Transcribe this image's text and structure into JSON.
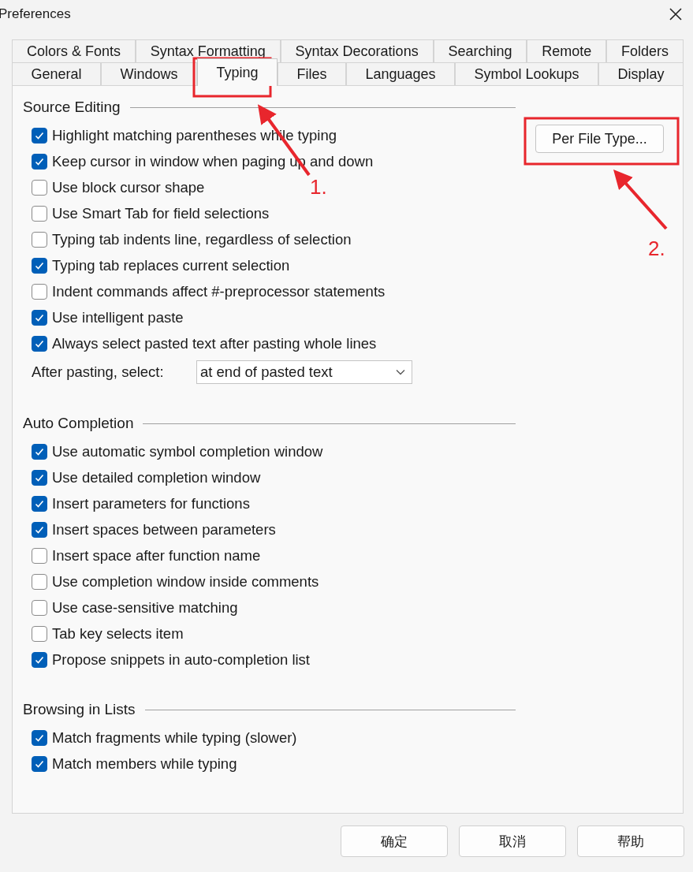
{
  "window": {
    "title": "Preferences"
  },
  "tab_rows": [
    [
      {
        "label": "Colors & Fonts",
        "selected": false
      },
      {
        "label": "Syntax Formatting",
        "selected": false
      },
      {
        "label": "Syntax Decorations",
        "selected": false
      },
      {
        "label": "Searching",
        "selected": false
      },
      {
        "label": "Remote",
        "selected": false
      },
      {
        "label": "Folders",
        "selected": false
      }
    ],
    [
      {
        "label": "General",
        "selected": false
      },
      {
        "label": "Windows",
        "selected": false
      },
      {
        "label": "Typing",
        "selected": true
      },
      {
        "label": "Files",
        "selected": false
      },
      {
        "label": "Languages",
        "selected": false
      },
      {
        "label": "Symbol Lookups",
        "selected": false
      },
      {
        "label": "Display",
        "selected": false
      }
    ]
  ],
  "per_file_type_button": "Per File Type...",
  "groups": [
    {
      "title": "Source Editing",
      "options": [
        {
          "label": "Highlight matching parentheses while typing",
          "checked": true
        },
        {
          "label": "Keep cursor in window when paging up and down",
          "checked": true
        },
        {
          "label": "Use block cursor shape",
          "checked": false
        },
        {
          "label": "Use Smart Tab for field selections",
          "checked": false
        },
        {
          "label": "Typing tab indents line, regardless of selection",
          "checked": false
        },
        {
          "label": "Typing tab replaces current selection",
          "checked": true
        },
        {
          "label": "Indent commands affect #-preprocessor statements",
          "checked": false
        },
        {
          "label": "Use intelligent paste",
          "checked": true
        },
        {
          "label": "Always select pasted text after pasting whole lines",
          "checked": true
        }
      ],
      "select": {
        "label": "After pasting, select:",
        "value": "at end of pasted text"
      }
    },
    {
      "title": "Auto Completion",
      "options": [
        {
          "label": "Use automatic symbol completion window",
          "checked": true
        },
        {
          "label": "Use detailed completion window",
          "checked": true
        },
        {
          "label": "Insert parameters for functions",
          "checked": true
        },
        {
          "label": "Insert spaces between parameters",
          "checked": true
        },
        {
          "label": "Insert space after function name",
          "checked": false
        },
        {
          "label": "Use completion window inside comments",
          "checked": false
        },
        {
          "label": "Use case-sensitive matching",
          "checked": false
        },
        {
          "label": "Tab key selects item",
          "checked": false
        },
        {
          "label": "Propose snippets in auto-completion list",
          "checked": true
        }
      ]
    },
    {
      "title": "Browsing in Lists",
      "options": [
        {
          "label": "Match fragments while typing (slower)",
          "checked": true
        },
        {
          "label": "Match members while typing",
          "checked": true
        }
      ]
    }
  ],
  "buttons": [
    "确定",
    "取消",
    "帮助"
  ],
  "annotations": [
    {
      "label": "1."
    },
    {
      "label": "2."
    }
  ]
}
